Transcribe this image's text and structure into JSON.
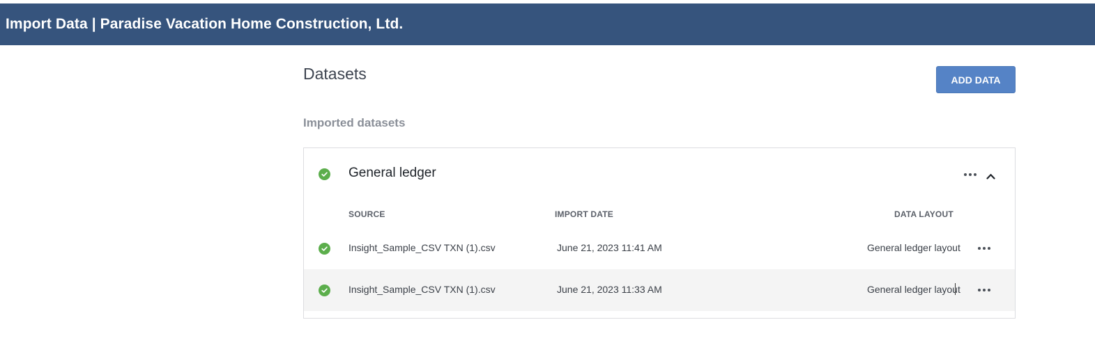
{
  "header": {
    "title": "Import Data | Paradise Vacation Home Construction, Ltd."
  },
  "page": {
    "heading": "Datasets",
    "add_button": "ADD DATA",
    "section_label": "Imported datasets"
  },
  "dataset": {
    "title": "General ledger",
    "status": "success",
    "columns": {
      "source": "SOURCE",
      "import_date": "IMPORT DATE",
      "data_layout": "DATA LAYOUT"
    },
    "rows": [
      {
        "source": "Insight_Sample_CSV TXN (1).csv",
        "import_date": "June 21, 2023 11:41 AM",
        "data_layout": "General ledger layout",
        "status": "success"
      },
      {
        "source": "Insight_Sample_CSV TXN (1).csv",
        "import_date": "June 21, 2023 11:33 AM",
        "data_layout": "General ledger layout",
        "status": "success"
      }
    ]
  },
  "colors": {
    "header_bg": "#36547d",
    "accent_button": "#5583c6",
    "success": "#5cae4c"
  }
}
